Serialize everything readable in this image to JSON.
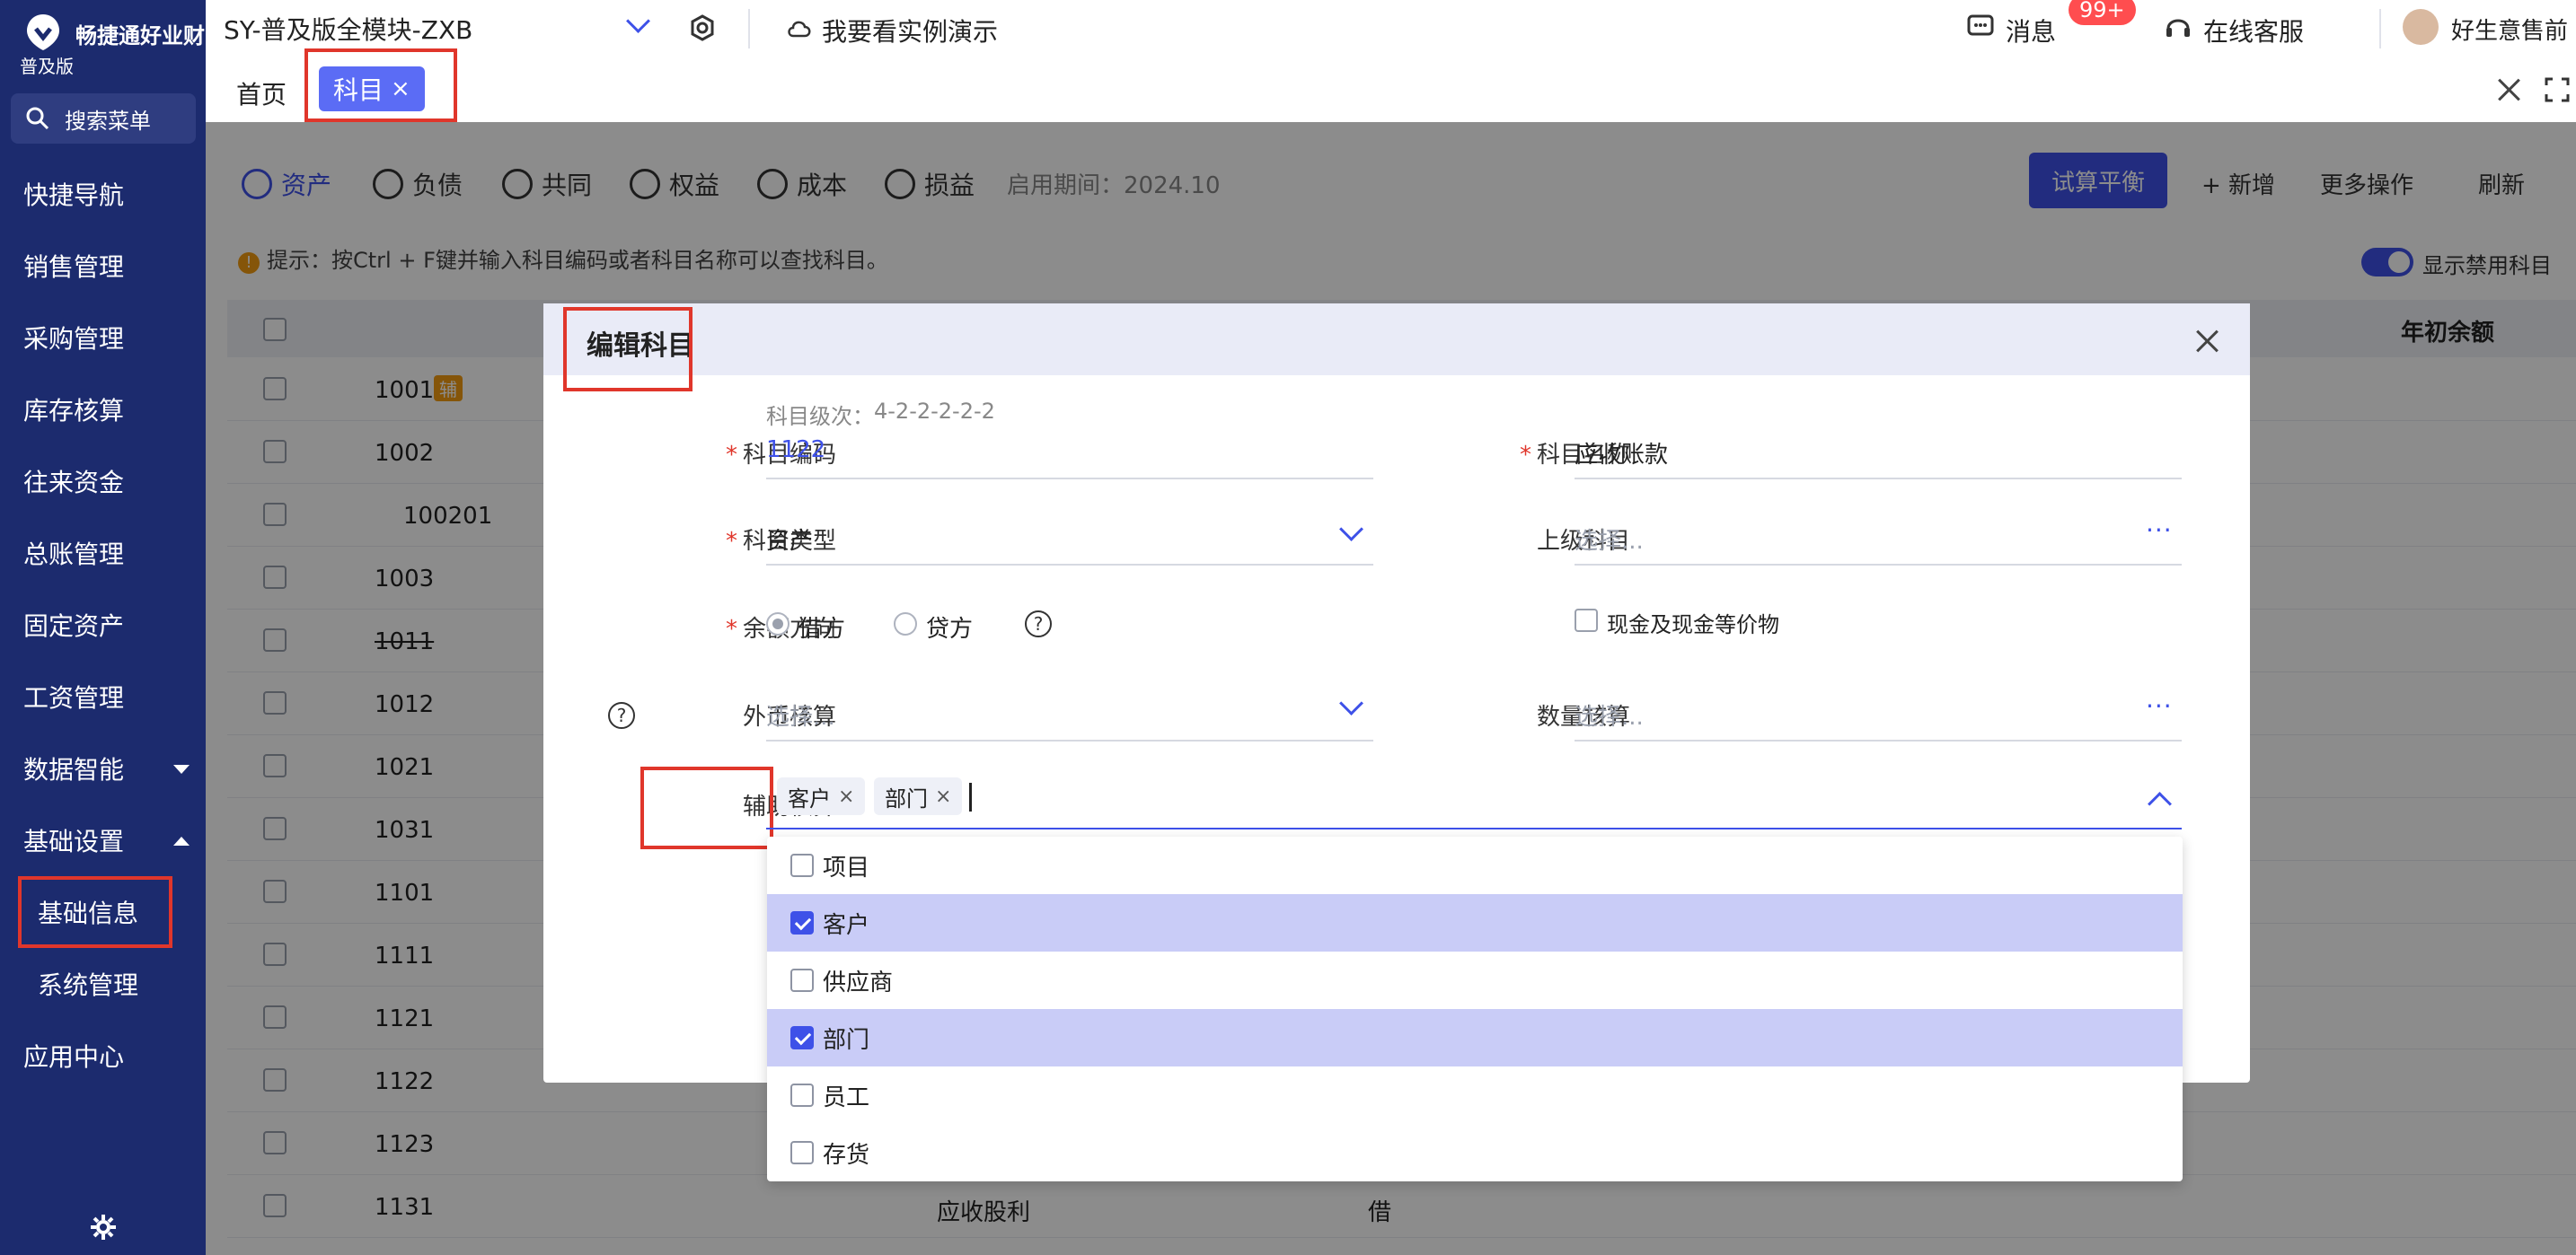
{
  "sidebar": {
    "brand": "畅捷通好业财",
    "edition": "普及版",
    "search": "搜索菜单",
    "items": [
      {
        "label": "快捷导航"
      },
      {
        "label": "销售管理"
      },
      {
        "label": "采购管理"
      },
      {
        "label": "库存核算"
      },
      {
        "label": "往来资金"
      },
      {
        "label": "总账管理"
      },
      {
        "label": "固定资产"
      },
      {
        "label": "工资管理"
      },
      {
        "label": "数据智能"
      },
      {
        "label": "基础设置"
      },
      {
        "label": "基础信息"
      },
      {
        "label": "系统管理"
      },
      {
        "label": "应用中心"
      }
    ]
  },
  "topbar": {
    "account": "SY-普及版全模块-ZXB",
    "demo": "我要看实例演示",
    "messages": "消息",
    "badge": "99+",
    "service": "在线客服",
    "user": "好生意售前"
  },
  "tabs": {
    "home": "首页",
    "active": "科目",
    "active_close": "×"
  },
  "content": {
    "categories": [
      "资产",
      "负债",
      "共同",
      "权益",
      "成本",
      "损益"
    ],
    "enable_period": "启用期间：2024.10",
    "trial_balance": "试算平衡",
    "add": "+ 新增",
    "more": "更多操作",
    "refresh": "刷新",
    "hint_icon": "!",
    "hint": "提示：按Ctrl + F键并输入科目编码或者科目名称可以查找科目。",
    "show_disabled": "显示禁用科目",
    "col_opening": "年初余额",
    "codes": [
      "1001",
      "1002",
      "100201",
      "1003",
      "1011",
      "1012",
      "1021",
      "1031",
      "1101",
      "1111",
      "1121",
      "1122",
      "1123",
      "1131"
    ],
    "tag_1001": "辅",
    "row_1131_name": "应收股利",
    "row_1131_dir": "借"
  },
  "dialog": {
    "title": "编辑科目",
    "level_label": "科目级次：",
    "level_value": "4-2-2-2-2-2",
    "code_label": "科目编码",
    "code_value": "1122",
    "name_label": "科目名称",
    "name_value": "应收账款",
    "type_label": "科目类型",
    "type_value": "资产",
    "parent_label": "上级科目",
    "parent_placeholder": "选择...",
    "balance_label": "余额方向",
    "debit": "借方",
    "credit": "贷方",
    "cash_equiv": "现金及现金等价物",
    "fx_label": "外币核算",
    "fx_placeholder": "选择...",
    "qty_label": "数量核算",
    "qty_placeholder": "选择...",
    "aux_label": "辅助核算",
    "aux_tags": [
      "客户",
      "部门"
    ],
    "aux_options": [
      {
        "label": "项目",
        "checked": false
      },
      {
        "label": "客户",
        "checked": true
      },
      {
        "label": "供应商",
        "checked": false
      },
      {
        "label": "部门",
        "checked": true
      },
      {
        "label": "员工",
        "checked": false
      },
      {
        "label": "存货",
        "checked": false
      }
    ]
  }
}
